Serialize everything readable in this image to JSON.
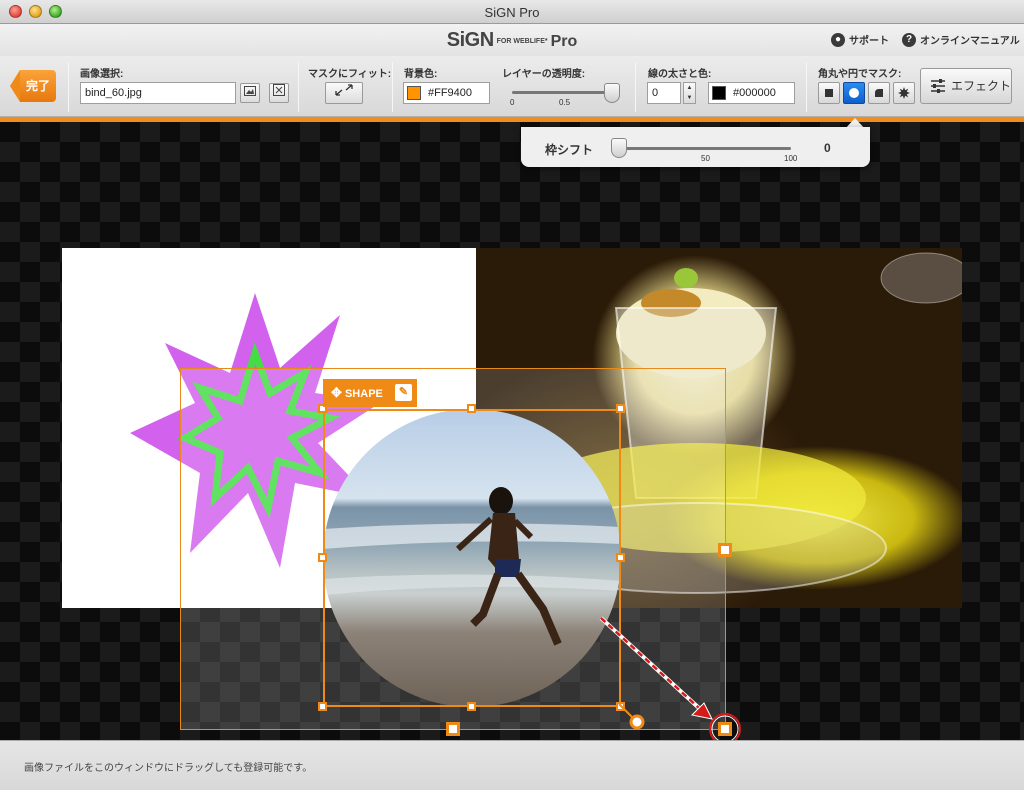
{
  "window": {
    "title": "SiGN Pro"
  },
  "app": {
    "logo_main": "SiGN",
    "logo_for": "FOR WEBLIFE*",
    "logo_pro": "Pro",
    "support_label": "サポート",
    "manual_label": "オンラインマニュアル"
  },
  "toolbar": {
    "done_label": "完了",
    "image_select_label": "画像選択:",
    "image_file": "bind_60.jpg",
    "fit_mask_label": "マスクにフィット:",
    "bg_color_label": "背景色:",
    "bg_color_value": "#FF9400",
    "bg_color": "#FF9400",
    "opacity_label": "レイヤーの透明度:",
    "opacity_tick_min": "0",
    "opacity_tick_mid": "0.5",
    "opacity_value": 1.0,
    "stroke_label": "線の太さと色:",
    "stroke_width": "0",
    "stroke_color_value": "#000000",
    "stroke_color": "#000000",
    "mask_label": "角丸や円でマスク:",
    "mask_options": [
      "square",
      "circle",
      "rounded-corner",
      "starburst"
    ],
    "mask_selected": "circle",
    "effect_label": "エフェクト"
  },
  "popover": {
    "label": "枠シフト",
    "tick_mid": "50",
    "tick_max": "100",
    "value": "0"
  },
  "canvas": {
    "shape_tag_label": "SHAPE"
  },
  "status": {
    "text": "画像ファイルをこのウィンドウにドラッグしても登録可能です。"
  }
}
